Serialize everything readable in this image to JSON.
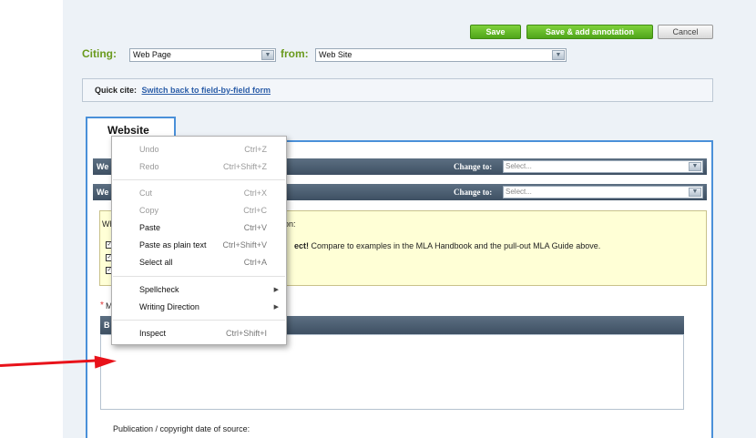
{
  "toolbar": {
    "save_label": "Save",
    "save_annotate_label": "Save & add annotation",
    "cancel_label": "Cancel"
  },
  "citing": {
    "label": "Citing:",
    "value": "Web Page",
    "from_label": "from:",
    "from_value": "Web Site"
  },
  "quick_cite": {
    "label": "Quick cite:",
    "link": "Switch back to field-by-field form"
  },
  "tab": {
    "label": "Website"
  },
  "rows": [
    {
      "label": "We",
      "change_label": "Change to:",
      "placeholder": "Select..."
    },
    {
      "label": "We",
      "change_label": "Change to:",
      "placeholder": "Select..."
    }
  ],
  "note": {
    "line1_prefix": "Wh",
    "line1_suffix": "tation:",
    "line2_bold": "ect!",
    "line2_rest": " Compare to examples in the MLA Handbook and the pull-out MLA Guide above."
  },
  "required_text": "M",
  "editor_bar_text": "B",
  "pub_label": "Publication / copyright date of source:",
  "context_menu": [
    {
      "label": "Undo",
      "shortcut": "Ctrl+Z",
      "disabled": true
    },
    {
      "label": "Redo",
      "shortcut": "Ctrl+Shift+Z",
      "disabled": true
    },
    {
      "label": "Cut",
      "shortcut": "Ctrl+X",
      "disabled": true
    },
    {
      "label": "Copy",
      "shortcut": "Ctrl+C",
      "disabled": true
    },
    {
      "label": "Paste",
      "shortcut": "Ctrl+V",
      "disabled": false
    },
    {
      "label": "Paste as plain text",
      "shortcut": "Ctrl+Shift+V",
      "disabled": false
    },
    {
      "label": "Select all",
      "shortcut": "Ctrl+A",
      "disabled": false
    },
    {
      "label": "Spellcheck",
      "shortcut": "",
      "disabled": false,
      "submenu": true
    },
    {
      "label": "Writing Direction",
      "shortcut": "",
      "disabled": false,
      "submenu": true
    },
    {
      "label": "Inspect",
      "shortcut": "Ctrl+Shift+I",
      "disabled": false
    }
  ],
  "colors": {
    "accent_green": "#5cb526",
    "panel_blue": "#4a90d9",
    "arrow_red": "#e8121a",
    "note_yellow": "#ffffd6"
  }
}
